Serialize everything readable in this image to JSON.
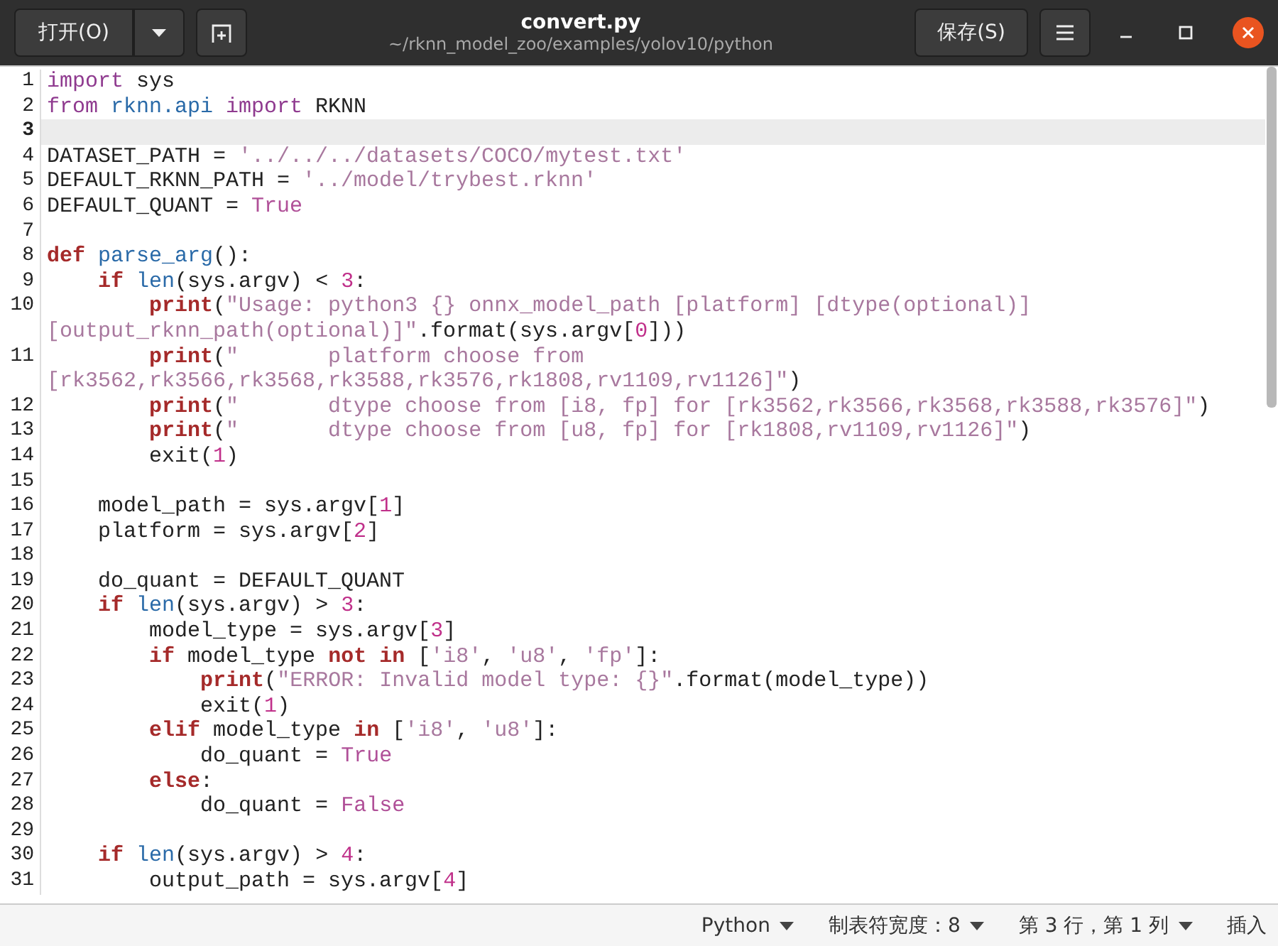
{
  "header": {
    "open_button": "打开(O)",
    "title": "convert.py",
    "subtitle": "~/rknn_model_zoo/examples/yolov10/python",
    "save_button": "保存(S)"
  },
  "editor": {
    "lines": [
      {
        "number": "1",
        "current": false,
        "tokens": [
          {
            "text": "import",
            "kind": "import"
          },
          {
            "text": " sys",
            "kind": "plain"
          }
        ]
      },
      {
        "number": "2",
        "current": false,
        "tokens": [
          {
            "text": "from",
            "kind": "import"
          },
          {
            "text": " rknn.api",
            "kind": "name"
          },
          {
            "text": " import",
            "kind": "import"
          },
          {
            "text": " RKNN",
            "kind": "plain"
          }
        ]
      },
      {
        "number": "3",
        "current": true
      },
      {
        "number": "4",
        "current": false,
        "tokens": [
          {
            "text": "DATASET_PATH = ",
            "kind": "plain"
          },
          {
            "text": "'../../../datasets/COCO/mytest.txt'",
            "kind": "string"
          }
        ]
      },
      {
        "number": "5",
        "current": false,
        "tokens": [
          {
            "text": "DEFAULT_RKNN_PATH = ",
            "kind": "plain"
          },
          {
            "text": "'../model/trybest.rknn'",
            "kind": "string"
          }
        ]
      },
      {
        "number": "6",
        "current": false,
        "tokens": [
          {
            "text": "DEFAULT_QUANT = ",
            "kind": "plain"
          },
          {
            "text": "True",
            "kind": "constant"
          }
        ]
      },
      {
        "number": "7",
        "current": false
      },
      {
        "number": "8",
        "current": false,
        "tokens": [
          {
            "text": "def",
            "kind": "keyword"
          },
          {
            "text": " parse_arg",
            "kind": "name"
          },
          {
            "text": "():",
            "kind": "plain"
          }
        ]
      },
      {
        "number": "9",
        "current": false,
        "tokens": [
          {
            "text": "    if",
            "kind": "keyword"
          },
          {
            "text": " len",
            "kind": "name"
          },
          {
            "text": "(sys.argv) < ",
            "kind": "plain"
          },
          {
            "text": "3",
            "kind": "number"
          },
          {
            "text": ":",
            "kind": "plain"
          }
        ]
      },
      {
        "number": "10",
        "current": false,
        "tokens": [
          {
            "text": "        print",
            "kind": "keyword"
          },
          {
            "text": "(",
            "kind": "plain"
          },
          {
            "text": "\"Usage: python3 {} onnx_model_path [platform] [dtype(optional)] [output_rknn_path(optional)]\"",
            "kind": "string"
          },
          {
            "text": ".format(sys.argv[",
            "kind": "plain"
          },
          {
            "text": "0",
            "kind": "number"
          },
          {
            "text": "]))",
            "kind": "plain"
          }
        ]
      },
      {
        "number": "11",
        "current": false,
        "tokens": [
          {
            "text": "        print",
            "kind": "keyword"
          },
          {
            "text": "(",
            "kind": "plain"
          },
          {
            "text": "\"       platform choose from [rk3562,rk3566,rk3568,rk3588,rk3576,rk1808,rv1109,rv1126]\"",
            "kind": "string"
          },
          {
            "text": ")",
            "kind": "plain"
          }
        ]
      },
      {
        "number": "12",
        "current": false,
        "tokens": [
          {
            "text": "        print",
            "kind": "keyword"
          },
          {
            "text": "(",
            "kind": "plain"
          },
          {
            "text": "\"       dtype choose from [i8, fp] for [rk3562,rk3566,rk3568,rk3588,rk3576]\"",
            "kind": "string"
          },
          {
            "text": ")",
            "kind": "plain"
          }
        ]
      },
      {
        "number": "13",
        "current": false,
        "tokens": [
          {
            "text": "        print",
            "kind": "keyword"
          },
          {
            "text": "(",
            "kind": "plain"
          },
          {
            "text": "\"       dtype choose from [u8, fp] for [rk1808,rv1109,rv1126]\"",
            "kind": "string"
          },
          {
            "text": ")",
            "kind": "plain"
          }
        ]
      },
      {
        "number": "14",
        "current": false,
        "tokens": [
          {
            "text": "        exit(",
            "kind": "plain"
          },
          {
            "text": "1",
            "kind": "number"
          },
          {
            "text": ")",
            "kind": "plain"
          }
        ]
      },
      {
        "number": "15",
        "current": false
      },
      {
        "number": "16",
        "current": false,
        "tokens": [
          {
            "text": "    model_path = sys.argv[",
            "kind": "plain"
          },
          {
            "text": "1",
            "kind": "number"
          },
          {
            "text": "]",
            "kind": "plain"
          }
        ]
      },
      {
        "number": "17",
        "current": false,
        "tokens": [
          {
            "text": "    platform = sys.argv[",
            "kind": "plain"
          },
          {
            "text": "2",
            "kind": "number"
          },
          {
            "text": "]",
            "kind": "plain"
          }
        ]
      },
      {
        "number": "18",
        "current": false
      },
      {
        "number": "19",
        "current": false,
        "tokens": [
          {
            "text": "    do_quant = DEFAULT_QUANT",
            "kind": "plain"
          }
        ]
      },
      {
        "number": "20",
        "current": false,
        "tokens": [
          {
            "text": "    if",
            "kind": "keyword"
          },
          {
            "text": " len",
            "kind": "name"
          },
          {
            "text": "(sys.argv) > ",
            "kind": "plain"
          },
          {
            "text": "3",
            "kind": "number"
          },
          {
            "text": ":",
            "kind": "plain"
          }
        ]
      },
      {
        "number": "21",
        "current": false,
        "tokens": [
          {
            "text": "        model_type = sys.argv[",
            "kind": "plain"
          },
          {
            "text": "3",
            "kind": "number"
          },
          {
            "text": "]",
            "kind": "plain"
          }
        ]
      },
      {
        "number": "22",
        "current": false,
        "tokens": [
          {
            "text": "        if",
            "kind": "keyword"
          },
          {
            "text": " model_type ",
            "kind": "plain"
          },
          {
            "text": "not in",
            "kind": "keyword"
          },
          {
            "text": " [",
            "kind": "plain"
          },
          {
            "text": "'i8'",
            "kind": "string"
          },
          {
            "text": ", ",
            "kind": "plain"
          },
          {
            "text": "'u8'",
            "kind": "string"
          },
          {
            "text": ", ",
            "kind": "plain"
          },
          {
            "text": "'fp'",
            "kind": "string"
          },
          {
            "text": "]:",
            "kind": "plain"
          }
        ]
      },
      {
        "number": "23",
        "current": false,
        "tokens": [
          {
            "text": "            print",
            "kind": "keyword"
          },
          {
            "text": "(",
            "kind": "plain"
          },
          {
            "text": "\"ERROR: Invalid model type: {}\"",
            "kind": "string"
          },
          {
            "text": ".format(model_type))",
            "kind": "plain"
          }
        ]
      },
      {
        "number": "24",
        "current": false,
        "tokens": [
          {
            "text": "            exit(",
            "kind": "plain"
          },
          {
            "text": "1",
            "kind": "number"
          },
          {
            "text": ")",
            "kind": "plain"
          }
        ]
      },
      {
        "number": "25",
        "current": false,
        "tokens": [
          {
            "text": "        elif",
            "kind": "keyword"
          },
          {
            "text": " model_type ",
            "kind": "plain"
          },
          {
            "text": "in",
            "kind": "keyword"
          },
          {
            "text": " [",
            "kind": "plain"
          },
          {
            "text": "'i8'",
            "kind": "string"
          },
          {
            "text": ", ",
            "kind": "plain"
          },
          {
            "text": "'u8'",
            "kind": "string"
          },
          {
            "text": "]:",
            "kind": "plain"
          }
        ]
      },
      {
        "number": "26",
        "current": false,
        "tokens": [
          {
            "text": "            do_quant = ",
            "kind": "plain"
          },
          {
            "text": "True",
            "kind": "constant"
          }
        ]
      },
      {
        "number": "27",
        "current": false,
        "tokens": [
          {
            "text": "        else",
            "kind": "keyword"
          },
          {
            "text": ":",
            "kind": "plain"
          }
        ]
      },
      {
        "number": "28",
        "current": false,
        "tokens": [
          {
            "text": "            do_quant = ",
            "kind": "plain"
          },
          {
            "text": "False",
            "kind": "constant"
          }
        ]
      },
      {
        "number": "29",
        "current": false
      },
      {
        "number": "30",
        "current": false,
        "tokens": [
          {
            "text": "    if",
            "kind": "keyword"
          },
          {
            "text": " len",
            "kind": "name"
          },
          {
            "text": "(sys.argv) > ",
            "kind": "plain"
          },
          {
            "text": "4",
            "kind": "number"
          },
          {
            "text": ":",
            "kind": "plain"
          }
        ]
      },
      {
        "number": "31",
        "current": false,
        "tokens": [
          {
            "text": "        output_path = sys.argv[",
            "kind": "plain"
          },
          {
            "text": "4",
            "kind": "number"
          },
          {
            "text": "]",
            "kind": "plain"
          }
        ]
      }
    ]
  },
  "status_bar": {
    "language": "Python",
    "tab_width": "制表符宽度：8",
    "position": "第 3 行，第 1 列",
    "mode": "插入"
  }
}
